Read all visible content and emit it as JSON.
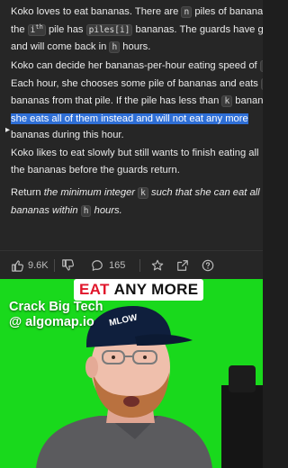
{
  "problem": {
    "p1": {
      "l1_a": "Koko loves to eat bananas. There are ",
      "l1_code": "n",
      "l1_b": " piles of bananas,",
      "l2_a": "the ",
      "l2_code": "i",
      "l2_sup": "th",
      "l2_b": " pile has ",
      "l2_code2": "piles[i]",
      "l2_c": " bananas. The guards have gone",
      "l3_a": "and will come back in ",
      "l3_code": "h",
      "l3_b": " hours."
    },
    "p2": {
      "l1_a": "Koko can decide her bananas-per-hour eating speed of ",
      "l1_code": "k",
      "l1_b": ".",
      "l2_a": "Each hour, she chooses some pile of bananas and eats ",
      "l2_code": "k",
      "l3_a": "bananas from that pile. If the pile has less than ",
      "l3_code": "k",
      "l3_b": " bananas,",
      "l4_highlight": "she eats all of them instead and will not eat any more",
      "l5": "bananas during this hour."
    },
    "p3": {
      "l1": "Koko likes to eat slowly but still wants to finish eating all",
      "l2": "the bananas before the guards return."
    },
    "p4": {
      "l1_a": "Return ",
      "l1_em": "the minimum integer ",
      "l1_code": "k",
      "l1_em2": " such that she can eat all the",
      "l2_em": "bananas within ",
      "l2_code": "h",
      "l2_em2": " hours."
    }
  },
  "actions": {
    "likes": "9.6K",
    "comments": "165"
  },
  "video": {
    "banner_word1": "EAT",
    "banner_word2": "ANY MORE",
    "overlay_line1": "Crack Big Tech",
    "overlay_line2": "@ algomap.io",
    "cap_text": "MLOW"
  },
  "colors": {
    "highlight": "#2f6fd6",
    "green_screen": "#19d91c",
    "banner_red": "#e0162b",
    "panel_bg": "#262626"
  },
  "icons": [
    "thumbs-up-icon",
    "thumbs-down-icon",
    "chat-bubble-icon",
    "star-icon",
    "share-icon",
    "help-circle-icon"
  ]
}
